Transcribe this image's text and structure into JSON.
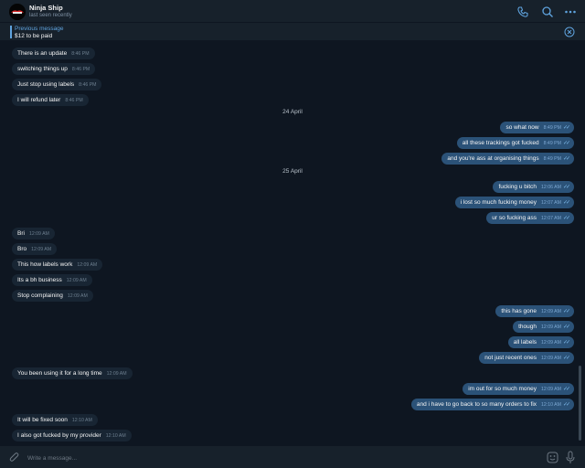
{
  "header": {
    "title": "Ninja Ship",
    "status": "last seen recently"
  },
  "pinned": {
    "title": "Previous message",
    "text": "$12 to be paid"
  },
  "composer": {
    "placeholder": "Write a message..."
  },
  "dates": [
    {
      "label": "24 April"
    },
    {
      "label": "25 April"
    }
  ],
  "messages": [
    {
      "dir": "in",
      "text": "There is an update",
      "time": "8:46 PM"
    },
    {
      "dir": "in",
      "text": "switching things up",
      "time": "8:46 PM"
    },
    {
      "dir": "in",
      "text": "Just stop using labels",
      "time": "8:46 PM"
    },
    {
      "dir": "in",
      "text": "I will refund later",
      "time": "8:46 PM"
    },
    {
      "dir": "out",
      "text": "so what now",
      "time": "8:49 PM"
    },
    {
      "dir": "out",
      "text": "all these trackings got fucked",
      "time": "8:49 PM"
    },
    {
      "dir": "out",
      "text": "and you're ass at organising things",
      "time": "8:49 PM"
    },
    {
      "dir": "out",
      "text": "fucking u bitch",
      "time": "12:06 AM"
    },
    {
      "dir": "out",
      "text": "i lost so much fucking money",
      "time": "12:07 AM"
    },
    {
      "dir": "out",
      "text": "ur so fucking ass",
      "time": "12:07 AM"
    },
    {
      "dir": "in",
      "text": "Bri",
      "time": "12:09 AM"
    },
    {
      "dir": "in",
      "text": "Bro",
      "time": "12:09 AM"
    },
    {
      "dir": "in",
      "text": "This how labels work",
      "time": "12:09 AM"
    },
    {
      "dir": "in",
      "text": "Its a bh business",
      "time": "12:09 AM"
    },
    {
      "dir": "in",
      "text": "Stop complaining",
      "time": "12:09 AM"
    },
    {
      "dir": "out",
      "text": "this has gone",
      "time": "12:09 AM"
    },
    {
      "dir": "out",
      "text": "though",
      "time": "12:09 AM"
    },
    {
      "dir": "out",
      "text": "all labels",
      "time": "12:09 AM"
    },
    {
      "dir": "out",
      "text": "not just recent ones",
      "time": "12:09 AM"
    },
    {
      "dir": "in",
      "text": "You been using it for a long time",
      "time": "12:09 AM"
    },
    {
      "dir": "out",
      "text": "im out for so much money",
      "time": "12:09 AM"
    },
    {
      "dir": "out",
      "text": "and i have to go back to so many orders to fix",
      "time": "12:10 AM"
    },
    {
      "dir": "in",
      "text": "It will be fixed soon",
      "time": "12:10 AM"
    },
    {
      "dir": "in",
      "text": "I also got fucked by my provider",
      "time": "12:10 AM"
    }
  ],
  "colors": {
    "accent": "#5fa3de",
    "bubble_out": "#2b5278",
    "bubble_in": "#182533",
    "background": "#0e1621"
  },
  "icons": [
    "phone-icon",
    "search-icon",
    "more-icon",
    "close-icon",
    "attach-icon",
    "sticker-icon",
    "microphone-icon",
    "check-read-icon"
  ]
}
